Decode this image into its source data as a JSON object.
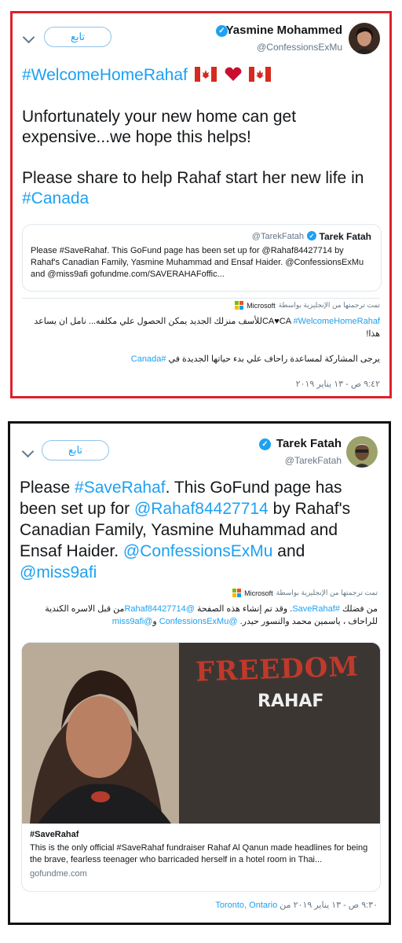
{
  "tweet1": {
    "name": "Yasmine Mohammed",
    "handle": "@ConfessionsExMu",
    "follow_label": "تابع",
    "hashtag": "#WelcomeHomeRahaf",
    "line2": "Unfortunately your new home can get expensive...we hope this helps!",
    "line3_pre": "Please share to help Rahaf start her new life in ",
    "line3_link": "#Canada",
    "quote": {
      "handle": "@TarekFatah",
      "name": "Tarek Fatah",
      "text": "Please #SaveRahaf. This GoFund page has been set up for @Rahaf84427714 by Rahaf's Canadian Family, Yasmine Muhammad and Ensaf Haider. @ConfessionsExMu and @miss9afi  gofundme.com/SAVERAHAFoffic..."
    },
    "translation": {
      "header": "تمت ترجمتها من الإنجليزية بواسطة",
      "brand": "Microsoft",
      "line1_prefix": "CA♥CA ",
      "line1_link": "#WelcomeHomeRahaf",
      "line1_text": "للأسف منزلك الجديد يمكن الحصول علي مكلفه... نامل ان يساعد هذا!",
      "line2_text": "يرجى المشاركة لمساعدة راحاف علي بدء حياتها الجديدة في ",
      "line2_link": "#Canada"
    },
    "timestamp": "٩:٤٢ ص - ١٣ يناير ٢٠١٩"
  },
  "tweet2": {
    "name": "Tarek Fatah",
    "handle": "@TarekFatah",
    "follow_label": "تابع",
    "body": {
      "t1": "Please ",
      "l1": "#SaveRahaf",
      "t2": ". This GoFund page has been set up for ",
      "l2": "@Rahaf84427714",
      "t3": " by Rahaf's Canadian Family, Yasmine Muhammad and Ensaf Haider. ",
      "l3": "@ConfessionsExMu",
      "t4": " and ",
      "l4": "@miss9afi"
    },
    "translation": {
      "header": "تمت ترجمتها من الإنجليزية بواسطة",
      "brand": "Microsoft",
      "t1": "من فضلك ",
      "l1": "#SaveRahaf",
      "t2": ". وقد تم إنشاء هذه الصفحة ",
      "l2": "@Rahaf84427714",
      "t3": "من قبل الاسره الكندية للراحاف ، ياسمين محمد والنسور حيدر. ",
      "l3": "@ConfessionsExMu",
      "t4": " و",
      "l4": "@miss9afi"
    },
    "card": {
      "image_text_1": "FREEDOM",
      "image_text_2": "RAHAF",
      "title": "#SaveRahaf",
      "description": "This is the only official #SaveRahaf fundraiser Rahaf Al Qanun made headlines for being the brave, fearless teenager who barricaded herself in a hotel room in Thai...",
      "domain": "gofundme.com"
    },
    "timestamp": "٩:٣٠ ص - ١٣ يناير ٢٠١٩ من ",
    "location": "Toronto, Ontario"
  },
  "colors": {
    "link": "#1da1f2",
    "frame1_border": "#e0212a",
    "frame2_border": "#111111",
    "muted": "#657786"
  }
}
